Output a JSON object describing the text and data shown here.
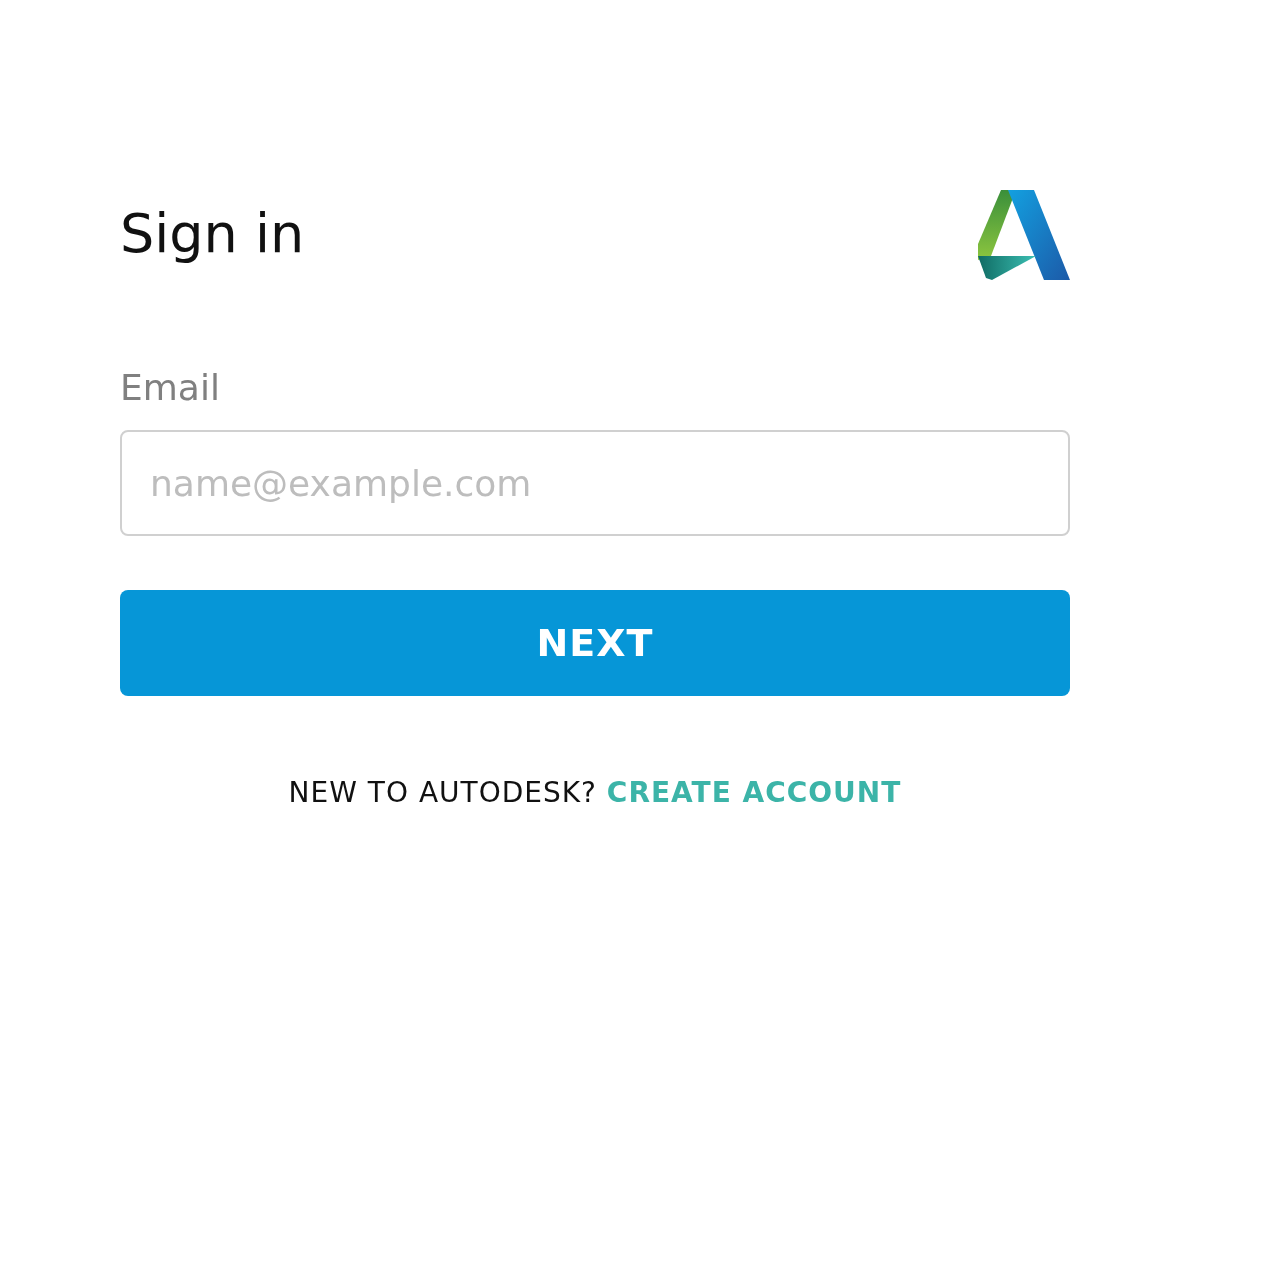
{
  "title": "Sign in",
  "email": {
    "label": "Email",
    "placeholder": "name@example.com"
  },
  "next_button": "NEXT",
  "footer": {
    "prompt": "NEW TO AUTODESK?",
    "link": "CREATE ACCOUNT"
  }
}
